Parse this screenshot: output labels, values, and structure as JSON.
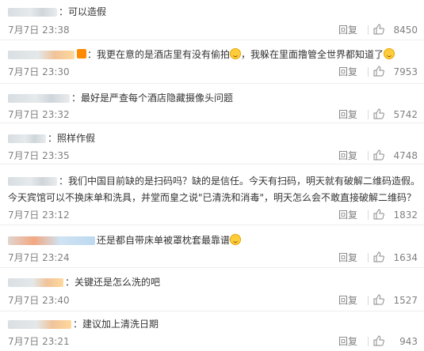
{
  "comments": [
    {
      "text": "可以造假",
      "time": "7月7日 23:38",
      "reply": "回复",
      "likes": "8450"
    },
    {
      "text": "我更在意的是酒店里有没有偷拍",
      "text2": "，我躲在里面撸管全世界都知道了",
      "time": "7月7日 23:30",
      "reply": "回复",
      "likes": "7953"
    },
    {
      "text": "最好是严查每个酒店隐藏摄像头问题",
      "time": "7月7日 23:32",
      "reply": "回复",
      "likes": "5742"
    },
    {
      "text": "照样作假",
      "time": "7月7日 23:35",
      "reply": "回复",
      "likes": "4748"
    },
    {
      "text": "我们中国目前缺的是扫码吗？缺的是信任。今天有扫码，明天就有破解二维码造假。",
      "text2": "今天宾馆可以不换床单和洗具，并堂而皇之说\"已清洗和消毒\"，明天怎么会不敢直接破解二维码？",
      "time": "7月7日 23:12",
      "reply": "回复",
      "likes": "1832"
    },
    {
      "text": "还是都自带床单被罩枕套最靠谱",
      "time": "7月7日 23:24",
      "reply": "回复",
      "likes": "1634"
    },
    {
      "text": "关键还是怎么洗的吧",
      "time": "7月7日 23:40",
      "reply": "回复",
      "likes": "1527"
    },
    {
      "text": "建议加上清洗日期",
      "time": "7月7日 23:21",
      "reply": "回复",
      "likes": "943"
    }
  ],
  "icons": {
    "like": "thumbs-up-icon",
    "emoji": "emoji-face-icon",
    "badge": "user-badge-icon"
  },
  "colors": {
    "meta": "#808080",
    "text": "#333333",
    "divider": "#eeeeee"
  }
}
